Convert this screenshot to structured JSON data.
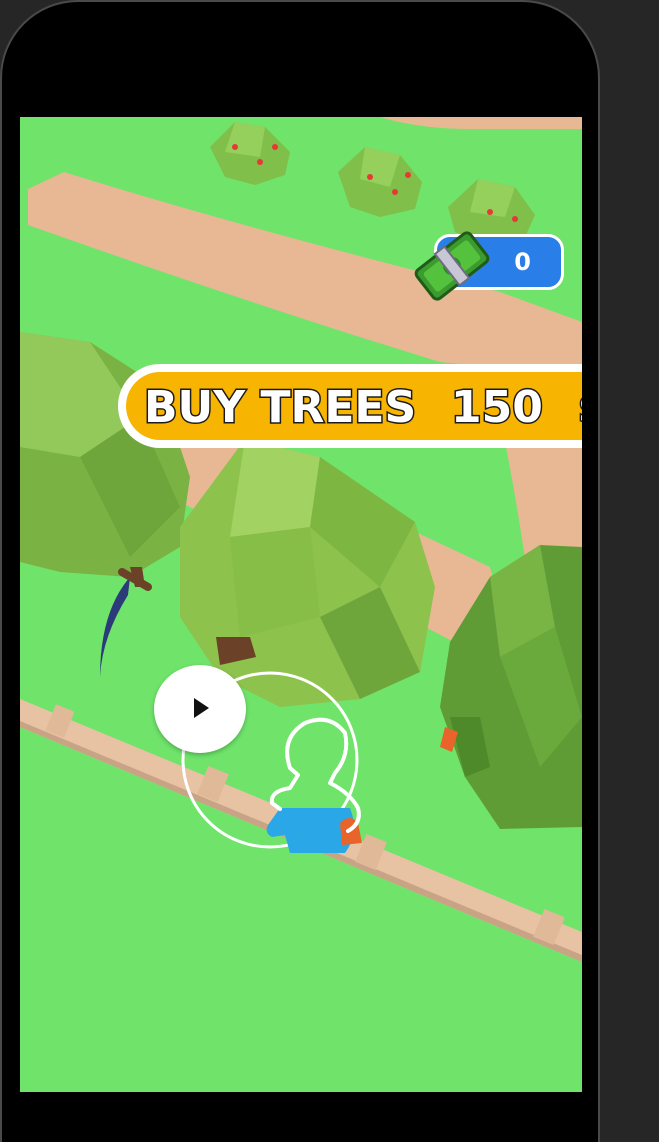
{
  "game": {
    "title": "BUY TREES",
    "cost_hint": "150",
    "currency_symbol": "$"
  },
  "hud": {
    "coins": "0",
    "cash_icon": "banknote-icon"
  },
  "controls": {
    "play_icon": "play-triangle-icon",
    "joystick": "virtual-joystick-ring"
  },
  "colors": {
    "grass": "#6fe36a",
    "path": "#e8b895",
    "banner": "#f7b400",
    "coin_pill": "#2a7ee8",
    "tree_light": "#8dc24c",
    "tree_dark": "#5f9c35",
    "fence": "#e7c3a4"
  }
}
